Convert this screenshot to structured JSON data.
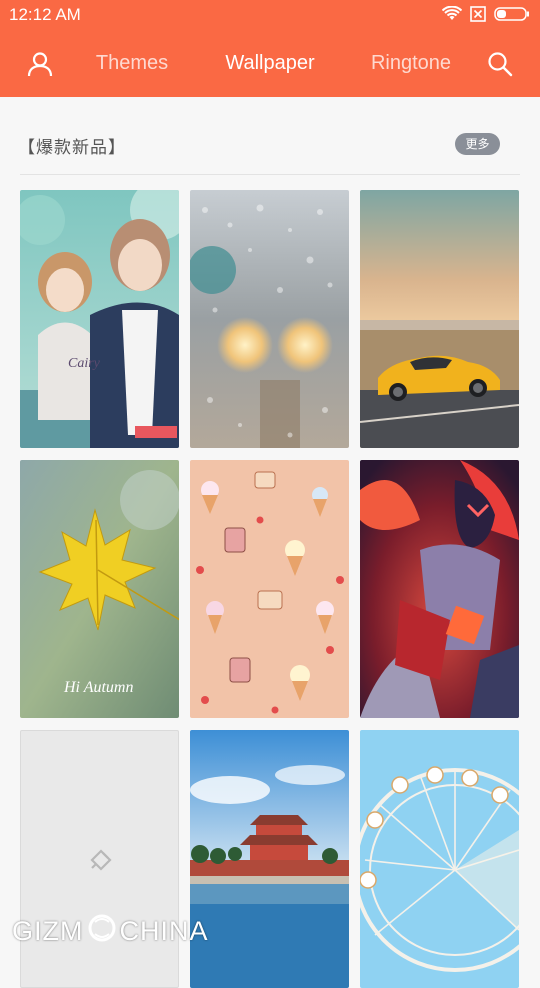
{
  "status_bar": {
    "time": "12:12 AM",
    "icons": [
      "wifi-icon",
      "sim-off-icon",
      "battery-icon"
    ]
  },
  "header": {
    "background": "#fa6944",
    "left_icon": "user-icon",
    "right_icon": "search-icon",
    "tabs": [
      {
        "label": "Themes",
        "active": false
      },
      {
        "label": "Wallpaper",
        "active": true
      },
      {
        "label": "Ringtone",
        "active": false
      }
    ]
  },
  "section": {
    "title": "【爆款新品】",
    "more_label": "更多"
  },
  "wallpapers": [
    {
      "subject": "anime-couple",
      "badge_text": "Cairy"
    },
    {
      "subject": "rain-window-bokeh"
    },
    {
      "subject": "yellow-sports-car"
    },
    {
      "subject": "yellow-maple-leaf",
      "caption": "Hi Autumn"
    },
    {
      "subject": "ice-cream-pattern"
    },
    {
      "subject": "game-character-red"
    },
    {
      "subject": "loading-placeholder"
    },
    {
      "subject": "palace-by-water"
    },
    {
      "subject": "ferris-wheel"
    }
  ],
  "watermark": {
    "left": "GIZM",
    "right": "CHINA"
  }
}
